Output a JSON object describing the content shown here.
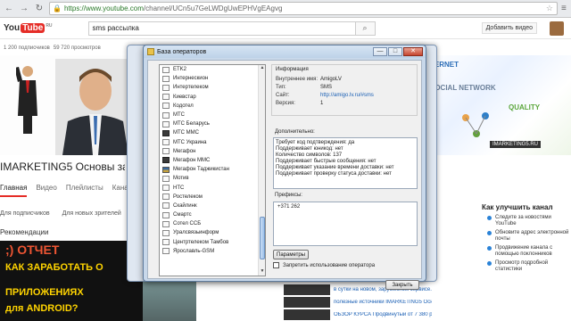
{
  "browser": {
    "url_scheme": "https://",
    "url_host": "www.youtube.com",
    "url_path": "/channel/UCn5u7GeLWDgUwEPHVgEAgvg"
  },
  "youtube": {
    "logo_you": "You",
    "logo_tube": "Tube",
    "logo_region": "RU",
    "search_value": "sms рассылка",
    "add_video_label": "Добавить видео",
    "subscribers": "1 200 подписчиков",
    "views": "59 720 просмотров",
    "channel_title": "IMARKETING5 Основы зарабо",
    "banner_brand": "IMARKETING5.RU",
    "banner_words": [
      "INTERNET",
      "SOCIAL NETWORK",
      "QUALITY"
    ],
    "tabs": [
      "Главная",
      "Видео",
      "Плейлисты",
      "Канал"
    ],
    "subfilters": [
      "Для подписчиков",
      "Для новых зрителей"
    ],
    "recommendations_label": "Рекомендации",
    "promo_lines": [
      ";) ОТЧЕТ",
      "КАК ЗАРАБОТАТЬ О",
      "ПРИЛОЖЕНИЯХ",
      "для ANDROID?"
    ]
  },
  "improve_channel": {
    "title": "Как улучшить канал",
    "items": [
      {
        "label": "Следите за новостями YouTube",
        "done": false
      },
      {
        "label": "Обновите адрес электронной почты",
        "done": false
      },
      {
        "label": "Продвижение канала с помощью поклонников",
        "done": false
      },
      {
        "label": "Просмотр подробной статистики",
        "done": false
      }
    ]
  },
  "video_list": [
    {
      "title": "в сутки на новом, зарубежном сервисе.",
      "extra": ""
    },
    {
      "title": "полезные источники IMARKETING5 Основы",
      "extra": ""
    },
    {
      "title": "ОБЗОР КУРСА Продвинутый от 7 380 рублей",
      "extra": ""
    }
  ],
  "dialog": {
    "title": "База операторов",
    "minimize": "—",
    "maximize": "□",
    "close": "✕",
    "operators": [
      {
        "name": "ETK2",
        "icon": "blank"
      },
      {
        "name": "Интернескион",
        "icon": "blank"
      },
      {
        "name": "Интертелеком",
        "icon": "blank"
      },
      {
        "name": "Киевстар",
        "icon": "blank"
      },
      {
        "name": "Кодотел",
        "icon": "blank"
      },
      {
        "name": "МТС",
        "icon": "blank"
      },
      {
        "name": "МТС Беларусь",
        "icon": "blank"
      },
      {
        "name": "МТС ММС",
        "icon": "dark"
      },
      {
        "name": "МТС Украина",
        "icon": "blank"
      },
      {
        "name": "Мегафон",
        "icon": "blank"
      },
      {
        "name": "Мегафон ММС",
        "icon": "dark"
      },
      {
        "name": "Мегафон Таджикистан",
        "icon": "flag"
      },
      {
        "name": "Мотив",
        "icon": "blank"
      },
      {
        "name": "НТС",
        "icon": "blank"
      },
      {
        "name": "Ростелеком",
        "icon": "blank"
      },
      {
        "name": "Скайлинк",
        "icon": "blank"
      },
      {
        "name": "Смартс",
        "icon": "blank"
      },
      {
        "name": "Сотел ССБ",
        "icon": "blank"
      },
      {
        "name": "Уралсвязьинформ",
        "icon": "blank"
      },
      {
        "name": "Центртелеком Тамбов",
        "icon": "blank"
      },
      {
        "name": "Ярославль-GSM",
        "icon": "blank"
      }
    ],
    "info": {
      "group_title": "Информация",
      "internal_name_label": "Внутреннее имя:",
      "internal_name_value": "AmigoLV",
      "type_label": "Тип:",
      "type_value": "SMS",
      "site_label": "Сайт:",
      "site_value": "http://amigo.lv.ru/#sms",
      "version_label": "Версия:",
      "version_value": "1"
    },
    "extra_title": "Дополнительно:",
    "extra_lines": [
      "Требует код подтверждения: да",
      "Поддерживает юникод: нет",
      "Количество символов: 137",
      "Поддерживает быстрые сообщения: нет",
      "Поддерживает указание времени доставки: нет",
      "Поддерживает проверку статуса доставки: нет"
    ],
    "prefix_title": "Префиксы:",
    "prefix_value": "+371 262",
    "params_button": "Параметры",
    "forbid_label": "Запретить использование оператора",
    "close_button": "Закрыть"
  }
}
